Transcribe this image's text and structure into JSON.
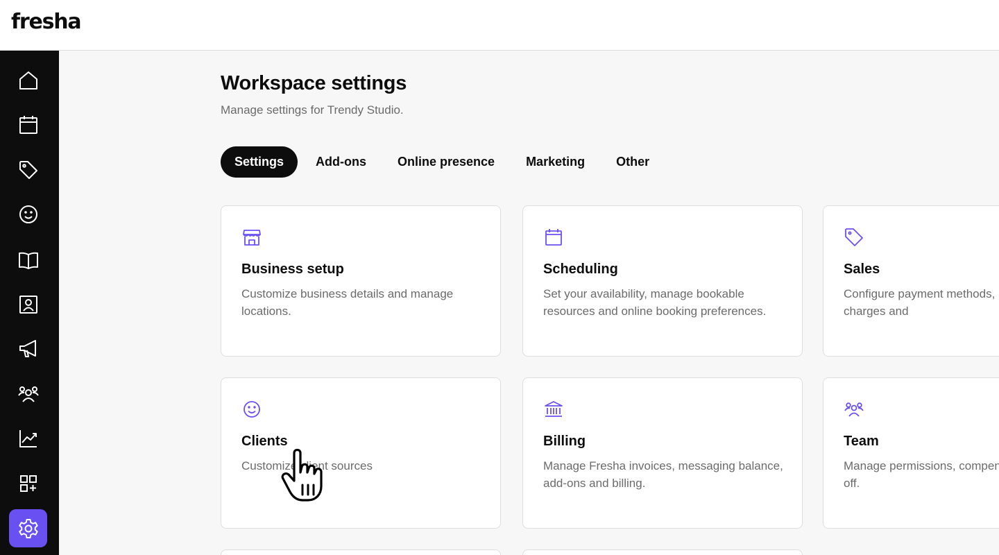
{
  "app": {
    "logo": "fresha"
  },
  "sidebar": {
    "items": [
      {
        "icon": "home-icon"
      },
      {
        "icon": "calendar-icon"
      },
      {
        "icon": "tag-icon"
      },
      {
        "icon": "smiley-icon"
      },
      {
        "icon": "book-icon"
      },
      {
        "icon": "contact-card-icon"
      },
      {
        "icon": "megaphone-icon"
      },
      {
        "icon": "team-icon"
      },
      {
        "icon": "chart-icon"
      },
      {
        "icon": "apps-add-icon"
      },
      {
        "icon": "gear-icon",
        "active": true
      }
    ],
    "active_color": "#6950f3"
  },
  "page": {
    "title": "Workspace settings",
    "subtitle": "Manage settings for Trendy Studio."
  },
  "tabs": [
    {
      "label": "Settings",
      "active": true
    },
    {
      "label": "Add-ons"
    },
    {
      "label": "Online presence"
    },
    {
      "label": "Marketing"
    },
    {
      "label": "Other"
    }
  ],
  "cards": [
    {
      "icon": "storefront-icon",
      "title": "Business setup",
      "desc": "Customize business details and manage locations."
    },
    {
      "icon": "calendar-icon",
      "title": "Scheduling",
      "desc": "Set your availability, manage bookable resources and online booking preferences."
    },
    {
      "icon": "tag-icon",
      "title": "Sales",
      "desc": "Configure payment methods, receipts, service charges and"
    },
    {
      "icon": "smiley-icon",
      "title": "Clients",
      "desc": "Customize client sources"
    },
    {
      "icon": "bank-icon",
      "title": "Billing",
      "desc": "Manage Fresha invoices, messaging balance, add-ons and billing."
    },
    {
      "icon": "team-icon",
      "title": "Team",
      "desc": "Manage permissions, compensation and time-off."
    }
  ],
  "colors": {
    "accent": "#6950f3",
    "icon": "#6950f3",
    "text": "#0d0d0d",
    "muted": "#6b6b6b"
  }
}
